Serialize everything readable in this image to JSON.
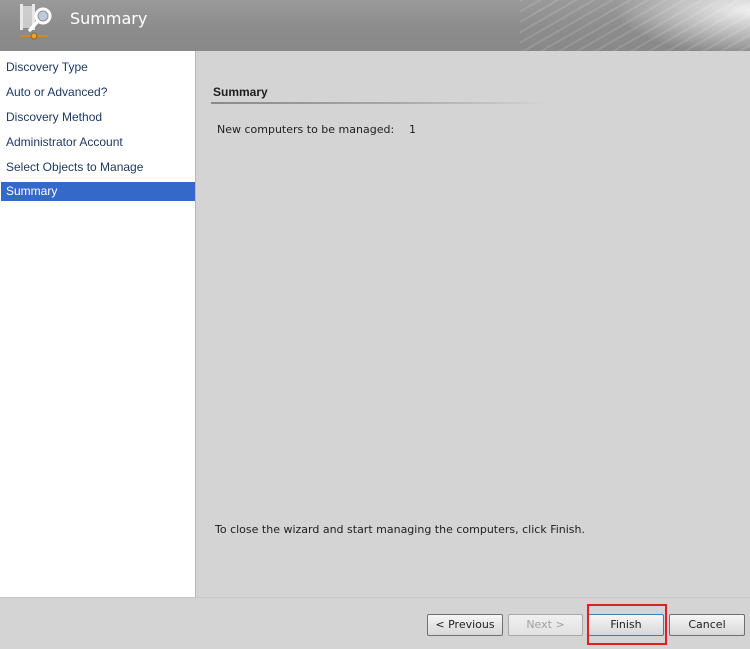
{
  "header": {
    "title": "Summary",
    "icon": "wizard-magnifier-icon"
  },
  "nav": {
    "items": [
      {
        "label": "Discovery Type",
        "selected": false
      },
      {
        "label": "Auto or Advanced?",
        "selected": false
      },
      {
        "label": "Discovery Method",
        "selected": false
      },
      {
        "label": "Administrator Account",
        "selected": false
      },
      {
        "label": "Select Objects to Manage",
        "selected": false
      },
      {
        "label": "Summary",
        "selected": true
      }
    ],
    "selected_color": "#3569c9"
  },
  "main": {
    "section_title": "Summary",
    "summary_label": "New computers to be managed:",
    "summary_value": "1",
    "instruction": "To close the wizard and start managing the computers, click Finish."
  },
  "footer": {
    "previous_label": "< Previous",
    "next_label": "Next >",
    "finish_label": "Finish",
    "cancel_label": "Cancel",
    "highlight_color": "#e02020"
  }
}
